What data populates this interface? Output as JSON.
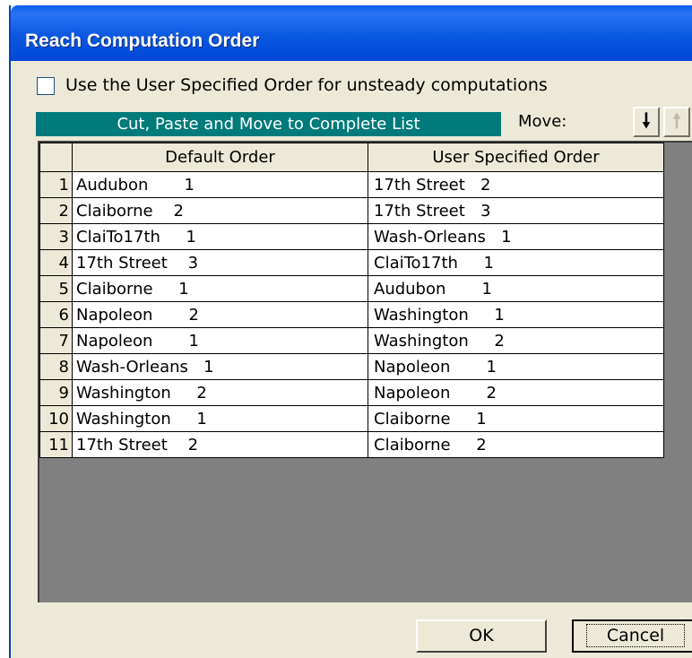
{
  "window": {
    "title": "Reach Computation Order"
  },
  "options": {
    "user_order_label": "Use the User Specified Order for unsteady computations",
    "user_order_checked": false
  },
  "toolbar": {
    "banner_text": "Cut, Paste and Move to Complete List",
    "move_label": "Move:",
    "down_icon": "arrow-down-icon",
    "up_icon": "arrow-up-icon",
    "down_glyph": "🠗",
    "up_glyph": "🠕"
  },
  "table": {
    "headers": {
      "default": "Default Order",
      "user": "User Specified Order"
    },
    "rows": [
      {
        "num": "1",
        "default": "Audubon       1",
        "user": "17th Street   2"
      },
      {
        "num": "2",
        "default": "Claiborne    2",
        "user": "17th Street   3"
      },
      {
        "num": "3",
        "default": "ClaiTo17th     1",
        "user": "Wash-Orleans   1"
      },
      {
        "num": "4",
        "default": "17th Street    3",
        "user": "ClaiTo17th     1"
      },
      {
        "num": "5",
        "default": "Claiborne     1",
        "user": "Audubon       1"
      },
      {
        "num": "6",
        "default": "Napoleon       2",
        "user": "Washington     1"
      },
      {
        "num": "7",
        "default": "Napoleon       1",
        "user": "Washington     2"
      },
      {
        "num": "8",
        "default": "Wash-Orleans   1",
        "user": "Napoleon       1"
      },
      {
        "num": "9",
        "default": "Washington     2",
        "user": "Napoleon       2"
      },
      {
        "num": "10",
        "default": "Washington     1",
        "user": "Claiborne     1"
      },
      {
        "num": "11",
        "default": "17th Street    2",
        "user": "Claiborne     2"
      }
    ]
  },
  "footer": {
    "ok_label": "OK",
    "cancel_label": "Cancel"
  },
  "colors": {
    "title_bar": "#0a58e0",
    "banner": "#007a7a",
    "dialog_bg": "#ece9d8",
    "grid_bg": "#808080"
  }
}
